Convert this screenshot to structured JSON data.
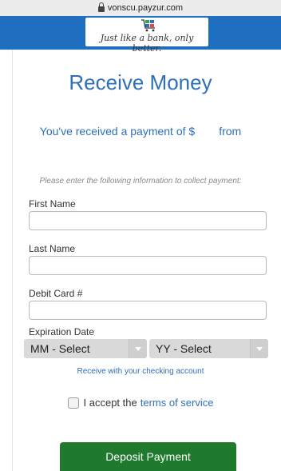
{
  "browser": {
    "url": "vonscu.payzur.com"
  },
  "brand": {
    "tagline": "Just like a bank, only better."
  },
  "page": {
    "title": "Receive Money",
    "received_prefix": "You've received a payment of $",
    "received_from": "from",
    "instructions": "Please enter the following information to collect payment:"
  },
  "form": {
    "first_name_label": "First Name",
    "last_name_label": "Last Name",
    "debit_card_label": "Debit Card #",
    "expiration_label": "Expiration Date",
    "month_select": "MM - Select",
    "year_select": "YY - Select",
    "checking_link": "Receive with your checking account",
    "accept_text": "I accept the",
    "terms_link": "terms of service",
    "deposit_button": "Deposit Payment"
  },
  "colors": {
    "brand_blue": "#1f6fc1",
    "link_blue": "#2e6fb9",
    "button_green": "#1f7a2e"
  }
}
